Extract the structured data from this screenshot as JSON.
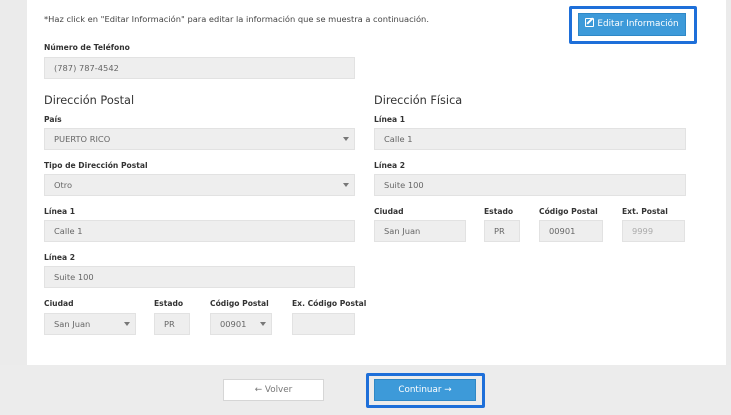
{
  "notice": "*Haz click en \"Editar Información\" para editar la información que se muestra a continuación.",
  "edit_button": {
    "label": "Editar Información",
    "icon": "edit-icon"
  },
  "phone": {
    "label": "Número de Teléfono",
    "value": "(787) 787-4542"
  },
  "postal": {
    "heading": "Dirección Postal",
    "country": {
      "label": "País",
      "value": "PUERTO RICO"
    },
    "type": {
      "label": "Tipo de Dirección Postal",
      "value": "Otro"
    },
    "line1": {
      "label": "Línea 1",
      "value": "Calle 1"
    },
    "line2": {
      "label": "Línea 2",
      "value": "Suite 100"
    },
    "city": {
      "label": "Ciudad",
      "value": "San Juan"
    },
    "state": {
      "label": "Estado",
      "value": "PR"
    },
    "zip": {
      "label": "Código Postal",
      "value": "00901"
    },
    "ext": {
      "label": "Ex. Código Postal",
      "value": ""
    }
  },
  "physical": {
    "heading": "Dirección Física",
    "line1": {
      "label": "Línea 1",
      "value": "Calle 1"
    },
    "line2": {
      "label": "Línea 2",
      "value": "Suite 100"
    },
    "city": {
      "label": "Ciudad",
      "value": "San Juan"
    },
    "state": {
      "label": "Estado",
      "value": "PR"
    },
    "zip": {
      "label": "Código Postal",
      "value": "00901"
    },
    "ext": {
      "label": "Ext. Postal",
      "placeholder": "9999"
    }
  },
  "footer": {
    "back_label": "← Volver",
    "continue_label": "Continuar →"
  },
  "colors": {
    "primary": "#3d9ad9",
    "highlight": "#1e6fd9",
    "field_bg": "#eeeeee"
  }
}
